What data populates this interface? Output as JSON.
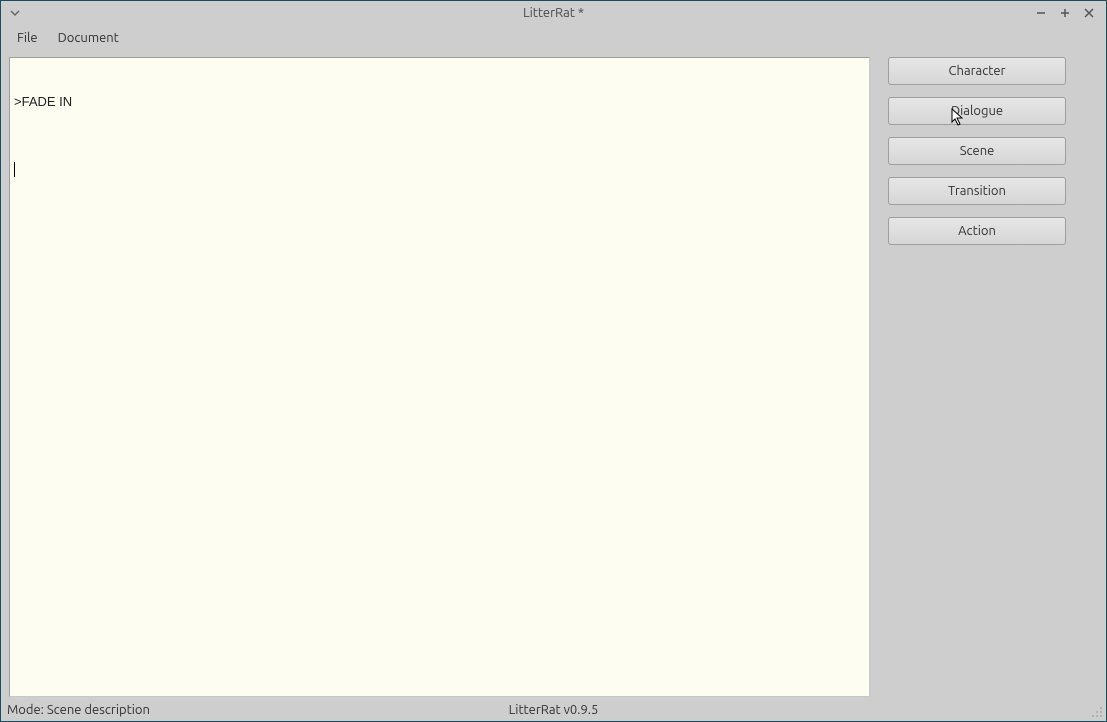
{
  "window": {
    "title": "LitterRat *"
  },
  "menubar": {
    "items": [
      "File",
      "Document"
    ]
  },
  "editor": {
    "content": ">FADE IN"
  },
  "sidebar": {
    "buttons": [
      {
        "label": "Character"
      },
      {
        "label": "Dialogue"
      },
      {
        "label": "Scene"
      },
      {
        "label": "Transition"
      },
      {
        "label": "Action"
      }
    ]
  },
  "statusbar": {
    "mode_label": "Mode: Scene description",
    "version_label": "LitterRat v0.9.5"
  }
}
